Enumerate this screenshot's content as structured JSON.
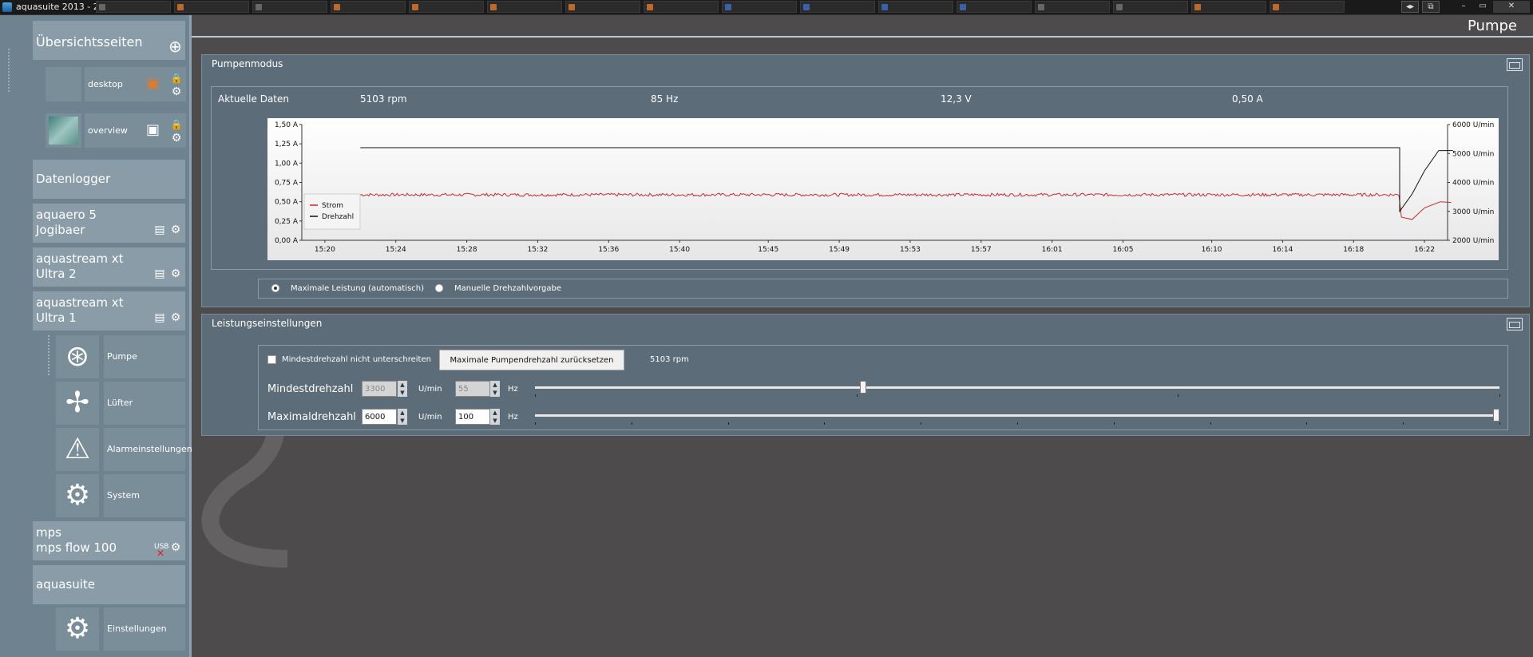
{
  "window": {
    "title": "aquasuite 2013 - 2"
  },
  "page": {
    "title": "Pumpe"
  },
  "sidebar": {
    "overview_header": "Übersichtsseiten",
    "pages": [
      {
        "label": "desktop"
      },
      {
        "label": "overview"
      }
    ],
    "datalogger": "Datenlogger",
    "devices": [
      {
        "line1": "aquaero 5",
        "line2": "Jogibaer"
      },
      {
        "line1": "aquastream xt",
        "line2": "Ultra 2"
      },
      {
        "line1": "aquastream xt",
        "line2": "Ultra 1"
      }
    ],
    "subitems": [
      {
        "label": "Pumpe"
      },
      {
        "label": "Lüfter"
      },
      {
        "label": "Alarmeinstellungen"
      },
      {
        "label": "System"
      }
    ],
    "mps": {
      "line1": "mps",
      "line2": "mps flow 100",
      "usb": "USB"
    },
    "aquasuite_header": "aquasuite",
    "settings": "Einstellungen"
  },
  "pumpenmodus": {
    "title": "Pumpenmodus",
    "current_label": "Aktuelle Daten",
    "rpm": "5103 rpm",
    "hz": "85 Hz",
    "volt": "12,3 V",
    "amp": "0,50 A",
    "radio_auto": "Maximale Leistung (automatisch)",
    "radio_manual": "Manuelle Drehzahlvorgabe"
  },
  "chart_data": {
    "type": "line",
    "x": [
      "15:20",
      "15:24",
      "15:28",
      "15:32",
      "15:36",
      "15:40",
      "15:45",
      "15:49",
      "15:53",
      "15:57",
      "16:01",
      "16:05",
      "16:10",
      "16:14",
      "16:18",
      "16:22"
    ],
    "y_left_ticks": [
      "1,50 A",
      "1,25 A",
      "1,00 A",
      "0,75 A",
      "0,50 A",
      "0,25 A",
      "0,00 A"
    ],
    "y_left_range": [
      0,
      1.5
    ],
    "y_right_ticks": [
      "6000 U/min",
      "5000 U/min",
      "4000 U/min",
      "3000 U/min",
      "2000 U/min"
    ],
    "y_right_range": [
      2000,
      6000
    ],
    "series": [
      {
        "name": "Strom",
        "color": "#cc2b2b",
        "axis": "left",
        "points": [
          [
            "15:22",
            0.59
          ],
          [
            "16:20",
            0.59
          ],
          [
            "16:20",
            0.3
          ],
          [
            "16:21",
            0.28
          ],
          [
            "16:22",
            0.5
          ]
        ]
      },
      {
        "name": "Drehzahl",
        "color": "#111111",
        "axis": "right",
        "points": [
          [
            "15:22",
            5200
          ],
          [
            "16:20",
            5200
          ],
          [
            "16:20",
            3000
          ],
          [
            "16:21",
            5100
          ],
          [
            "16:22",
            5100
          ]
        ]
      }
    ],
    "legend": "bottom-left"
  },
  "leistung": {
    "title": "Leistungseinstellungen",
    "checkbox_label": "Mindestdrehzahl nicht unterschreiten",
    "reset_button": "Maximale Pumpendrehzahl zurücksetzen",
    "reset_value": "5103 rpm",
    "min_label": "Mindestdrehzahl",
    "min_rpm": "3300",
    "min_hz": "55",
    "max_label": "Maximaldrehzahl",
    "max_rpm": "6000",
    "max_hz": "100",
    "unit_rpm": "U/min",
    "unit_hz": "Hz",
    "min_slider_fraction": 0.34,
    "max_slider_fraction": 1.0
  }
}
